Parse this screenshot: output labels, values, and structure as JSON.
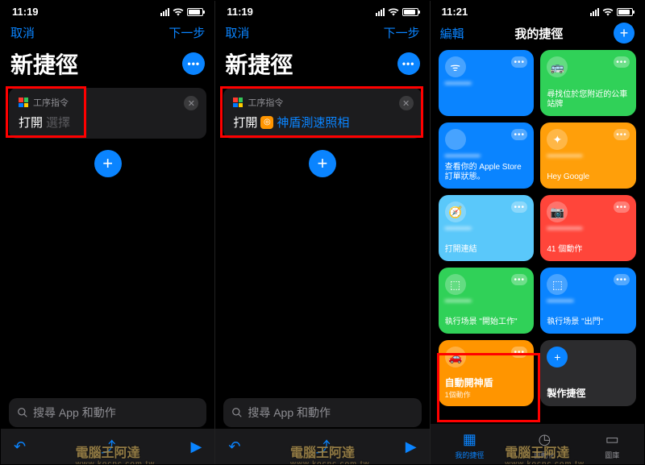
{
  "watermark": "電腦王阿達",
  "watermark_url": "www.kocpc.com.tw",
  "panels": {
    "left": {
      "time": "11:19",
      "cancel": "取消",
      "next": "下一步",
      "title": "新捷徑",
      "card_header": "工序指令",
      "open_label": "打開",
      "select_placeholder": "選擇",
      "search_placeholder": "搜尋 App 和動作"
    },
    "middle": {
      "time": "11:19",
      "cancel": "取消",
      "next": "下一步",
      "title": "新捷徑",
      "card_header": "工序指令",
      "open_label": "打開",
      "selected_app": "神盾測速照相",
      "search_placeholder": "搜尋 App 和動作"
    },
    "right": {
      "time": "11:21",
      "edit": "編輯",
      "title": "我的捷徑",
      "tabs": {
        "shortcuts": "我的捷徑",
        "automation": "自動化",
        "gallery": "圖庫"
      },
      "make": "製作捷徑",
      "shortcuts": [
        {
          "color": "#0a84ff",
          "icon": "wifi",
          "text": ""
        },
        {
          "color": "#30d158",
          "icon": "bus",
          "text": "尋找位於您附近的公車站牌"
        },
        {
          "color": "#0a84ff",
          "icon": "apple",
          "text": "查看你的 Apple Store 訂單狀態。"
        },
        {
          "color": "#ff9f0a",
          "icon": "sparkle",
          "text": "Hey Google"
        },
        {
          "color": "#64d2ff",
          "icon": "safari",
          "text": "打開連結"
        },
        {
          "color": "#ff453a",
          "icon": "camera",
          "text": "41 個動作"
        },
        {
          "color": "#30d158",
          "icon": "mi",
          "text": "執行场景 \"開始工作\""
        },
        {
          "color": "#0a84ff",
          "icon": "mi",
          "text": "執行场景 \"出門\""
        },
        {
          "color": "#ff9500",
          "icon": "car",
          "name": "自動開神盾",
          "sub": "1個動作"
        }
      ]
    }
  }
}
